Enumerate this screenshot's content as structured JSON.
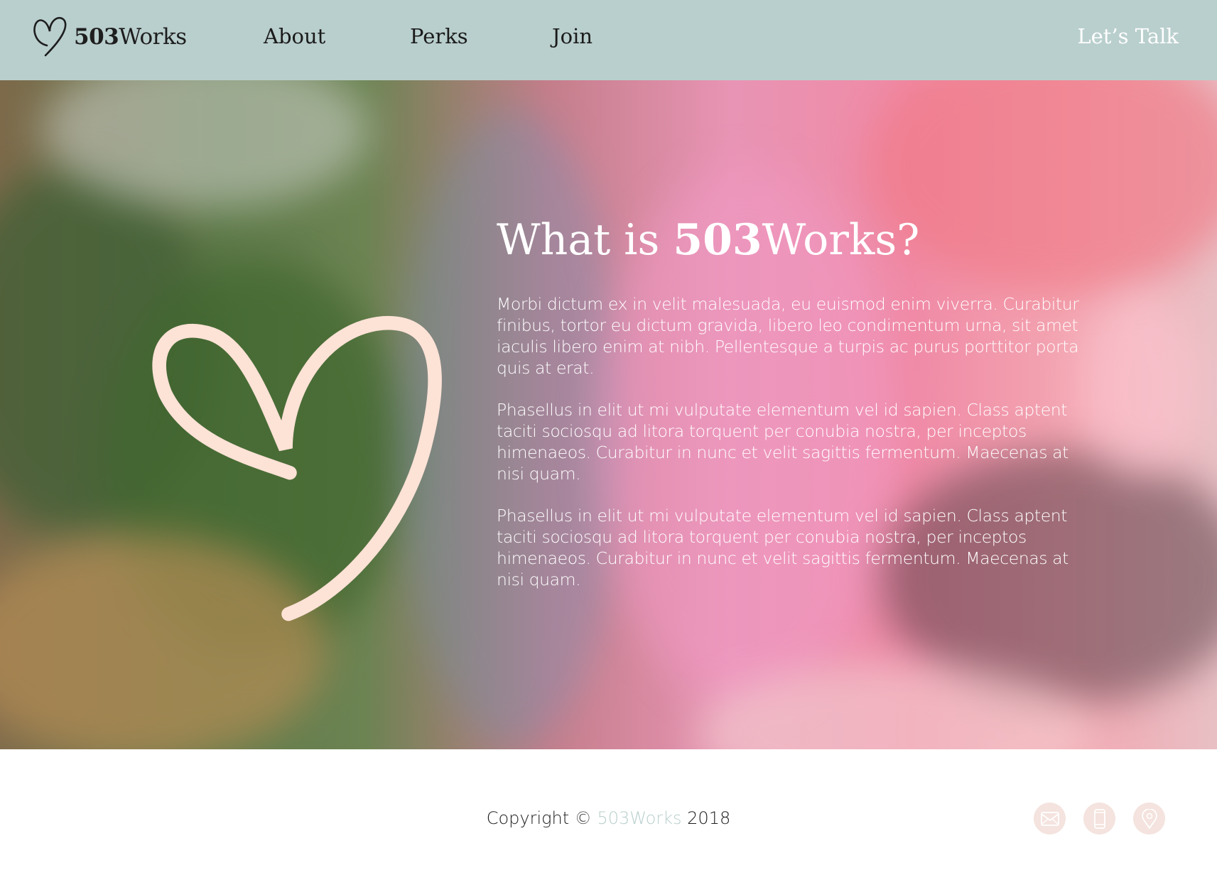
{
  "header": {
    "logo_bold": "503",
    "logo_rest": "Works",
    "logo_icon": "heart-outline-icon",
    "nav": {
      "about": "About",
      "perks": "Perks",
      "join": "Join"
    },
    "cta": "Let’s Talk",
    "bg_color": "#b9cfcd"
  },
  "hero": {
    "title_pre": "What is ",
    "title_bold": "503",
    "title_post": "Works?",
    "paragraphs": [
      "Morbi dictum ex in velit malesuada, eu euismod enim viverra. Curabitur finibus, tortor eu dictum gravida, libero leo condimentum urna, sit amet iaculis libero enim at nibh. Pellentesque a turpis ac purus porttitor porta quis at erat.",
      "Phasellus in elit ut mi vulputate elementum vel id sapien. Class aptent taciti sociosqu ad litora torquent per conubia nostra, per inceptos himenaeos. Curabitur in nunc et velit sagittis fermentum. Maecenas at nisi quam.",
      "Phasellus in elit ut mi vulputate elementum vel id sapien. Class aptent taciti sociosqu ad litora torquent per conubia nostra, per inceptos himenaeos. Curabitur in nunc et velit sagittis fermentum. Maecenas at nisi quam."
    ],
    "heart_color": "#fde2d6"
  },
  "footer": {
    "copyright_pre": "Copyright © ",
    "copyright_brand": "503Works",
    "copyright_post": " 2018",
    "icons": [
      "mail-icon",
      "phone-icon",
      "location-pin-icon"
    ],
    "icon_bg": "#f4e3de"
  }
}
